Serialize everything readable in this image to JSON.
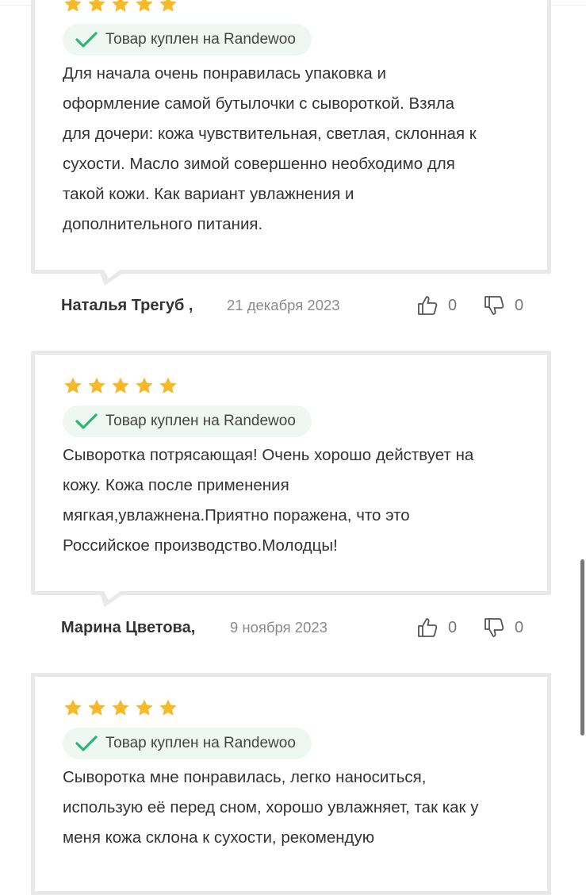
{
  "colors": {
    "star": "#f7b928",
    "check": "#2bb673",
    "badge_bg": "#eef7f1",
    "border": "#e9e9e9"
  },
  "reviews": [
    {
      "rating": 5,
      "badge": "Товар куплен на Randewoo",
      "lines": [
        "Для начала очень понравилась упаковка и",
        "оформление самой бутылочки с сывороткой. Взяла",
        "для дочери: кожа чувствительная, светлая, склонная к",
        "сухости. Масло зимой совершенно необходимо для",
        "такой кожи. Как вариант увлажнения и",
        "дополнительного питания."
      ],
      "author": "Наталья Трегуб ,",
      "date": "21 декабря 2023",
      "likes": "0",
      "dislikes": "0"
    },
    {
      "rating": 5,
      "badge": "Товар куплен на Randewoo",
      "lines": [
        "Сыворотка потрясающая! Очень хорошо действует на",
        "кожу. Кожа после применения",
        "мягкая,увлажнена.Приятно поражена, что это",
        "Российское производство.Молодцы!"
      ],
      "author": "Марина Цветова,",
      "date": "9 ноября 2023",
      "likes": "0",
      "dislikes": "0"
    },
    {
      "rating": 5,
      "badge": "Товар куплен на Randewoo",
      "lines": [
        "Сыворотка мне понравилась, легко наноситься,",
        "использую её перед сном, хорошо увлажняет, так как у",
        "меня кожа склона к сухости, рекомендую"
      ]
    }
  ]
}
